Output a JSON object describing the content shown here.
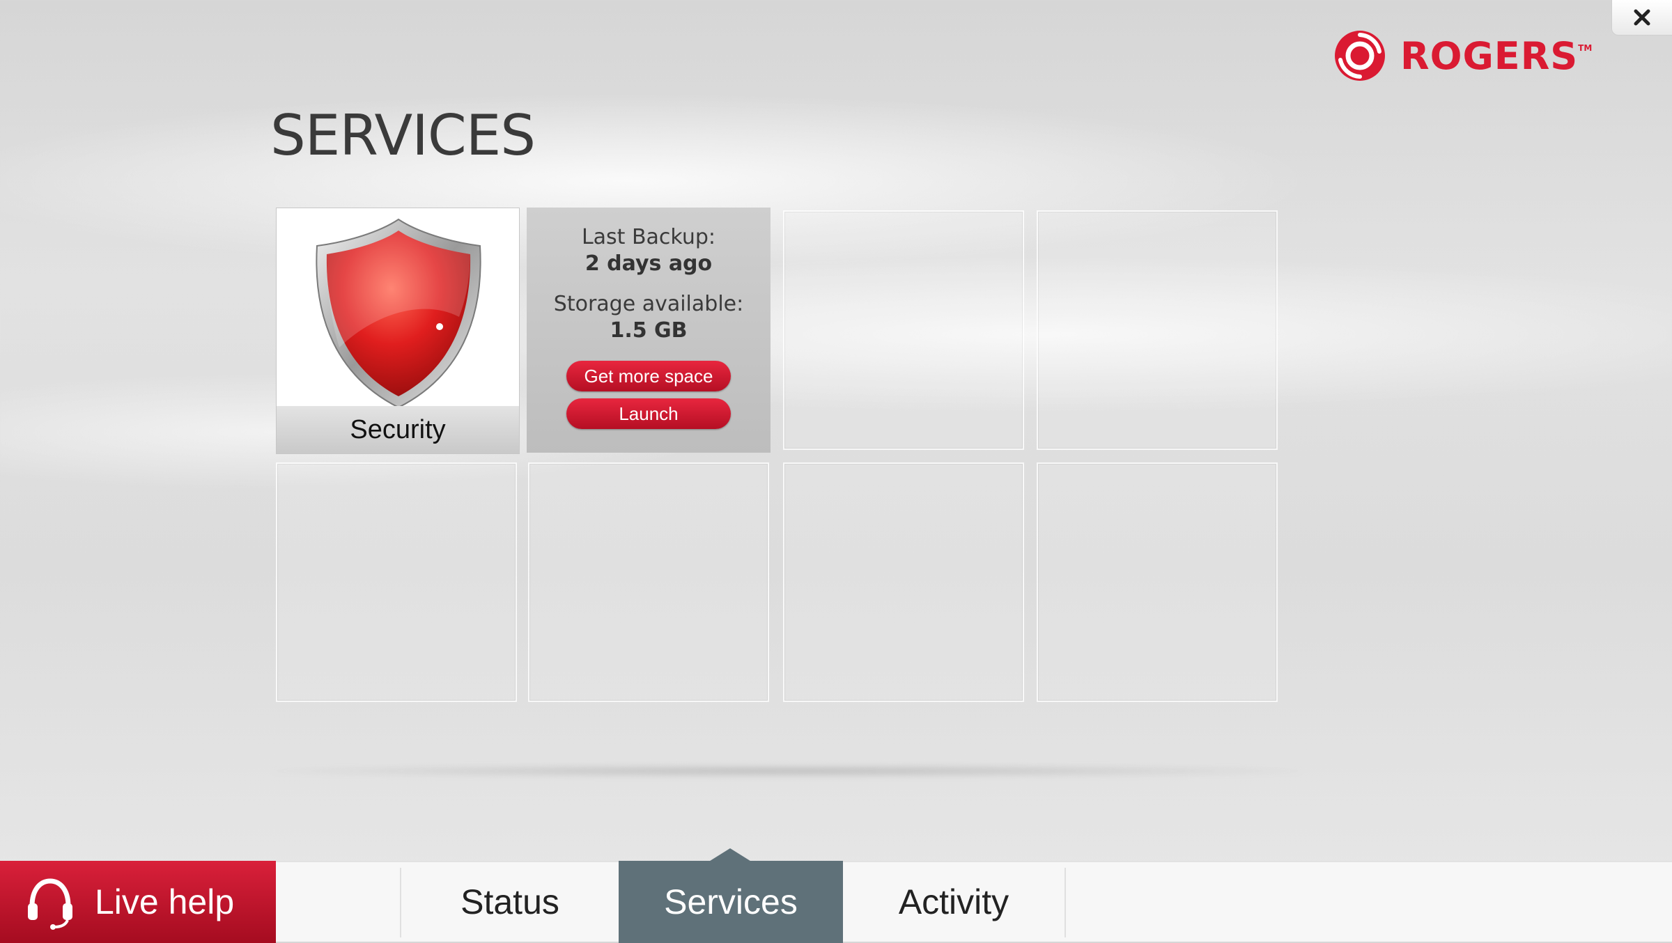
{
  "window": {
    "close_icon": "close-icon"
  },
  "brand": {
    "name": "ROGERS",
    "tm": "TM",
    "color": "#da1a32"
  },
  "page": {
    "title": "SERVICES"
  },
  "tiles": {
    "security": {
      "label": "Security",
      "icon": "shield-icon"
    },
    "backup": {
      "last_backup_label": "Last Backup:",
      "last_backup_value": "2 days ago",
      "storage_label": "Storage available:",
      "storage_value": "1.5 GB",
      "get_more_space": "Get more space",
      "launch": "Launch"
    }
  },
  "nav": {
    "live_help": "Live help",
    "tabs": [
      {
        "label": "Status",
        "active": false
      },
      {
        "label": "Services",
        "active": true
      },
      {
        "label": "Activity",
        "active": false
      }
    ],
    "active_color": "#5f7179"
  }
}
